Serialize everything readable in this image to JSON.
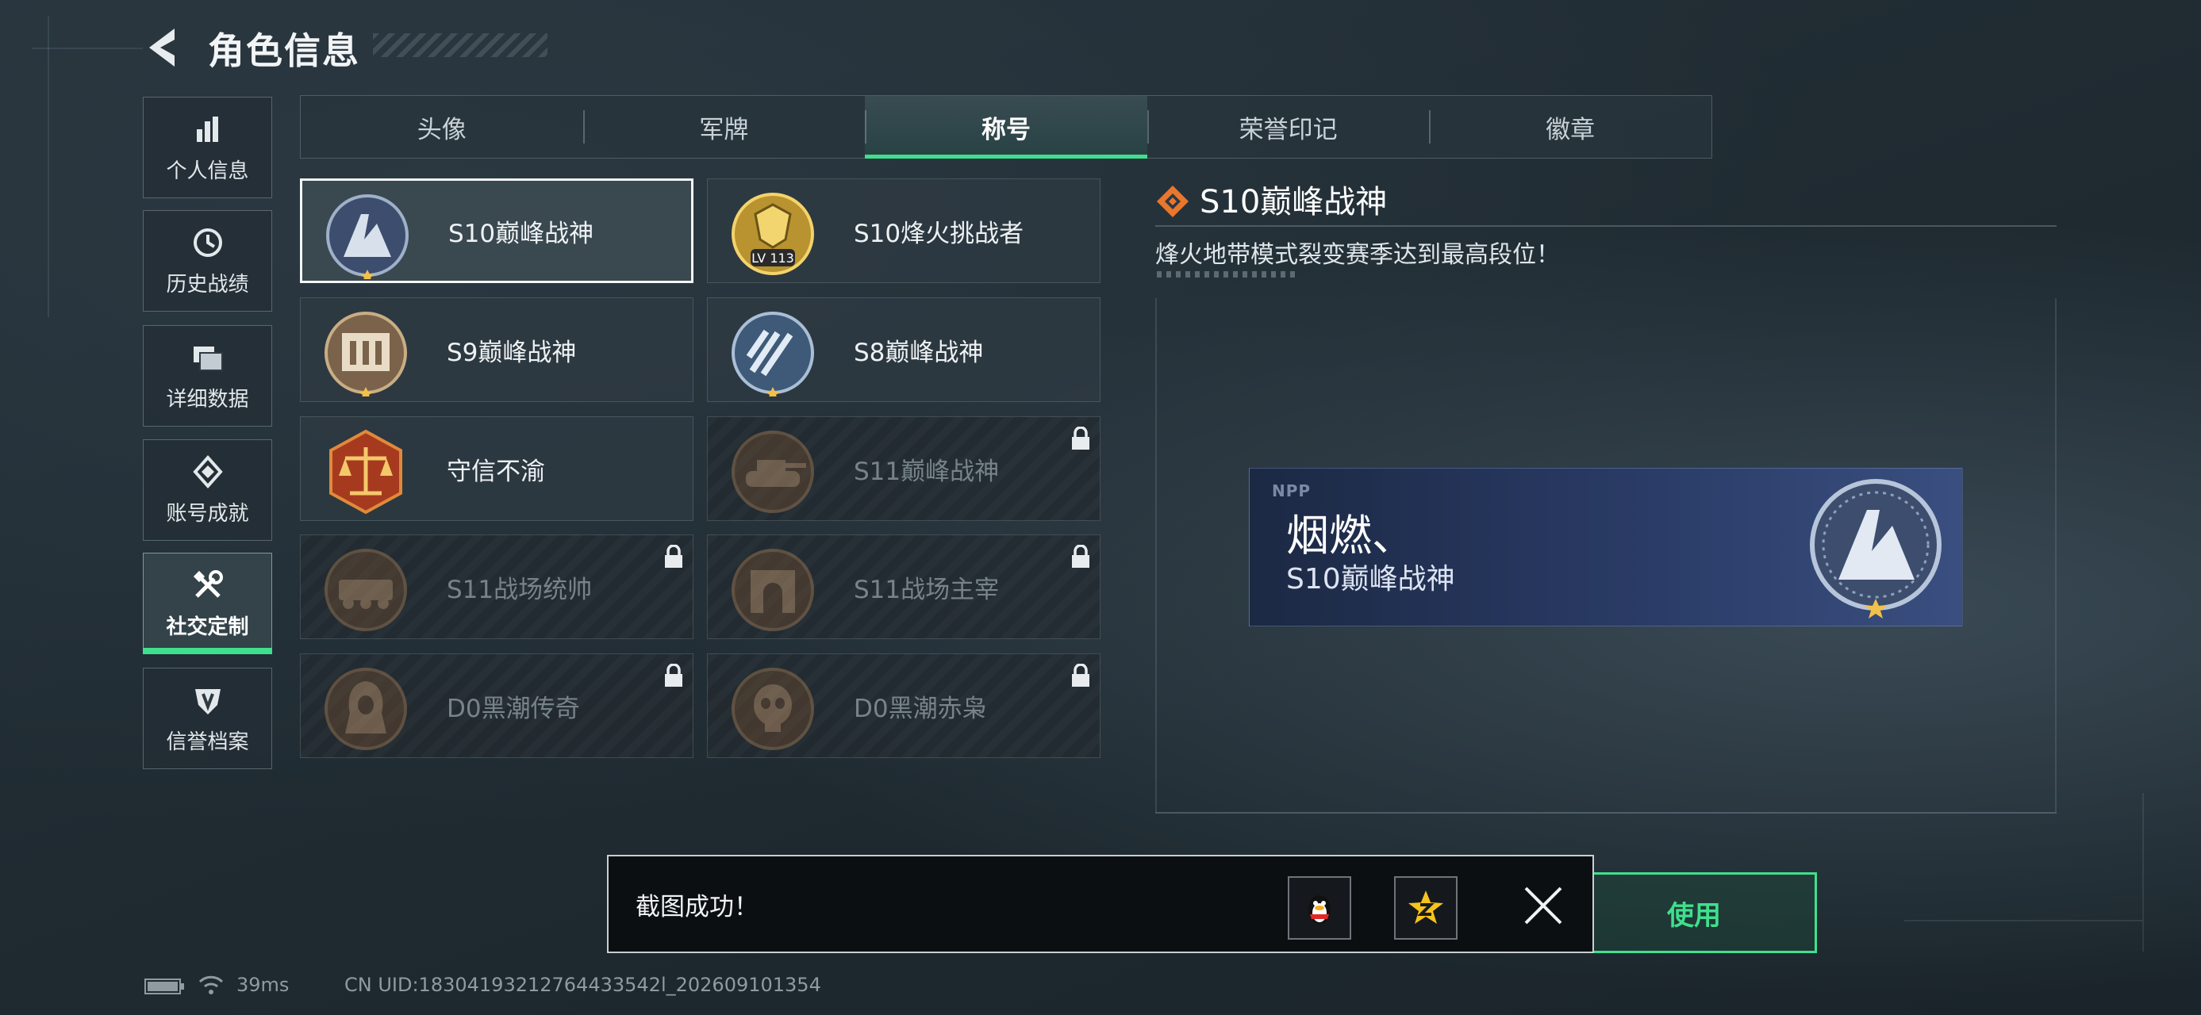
{
  "header": {
    "title": "角色信息"
  },
  "sidebar": {
    "items": [
      {
        "label": "个人信息",
        "icon": "bar-chart-icon"
      },
      {
        "label": "历史战绩",
        "icon": "clock-icon"
      },
      {
        "label": "详细数据",
        "icon": "folder-icon"
      },
      {
        "label": "账号成就",
        "icon": "achievement-icon"
      },
      {
        "label": "社交定制",
        "icon": "tools-icon",
        "active": true
      },
      {
        "label": "信誉档案",
        "icon": "shield-icon"
      }
    ]
  },
  "tabs": [
    {
      "label": "头像"
    },
    {
      "label": "军牌"
    },
    {
      "label": "称号",
      "active": true
    },
    {
      "label": "荣誉印记"
    },
    {
      "label": "徽章"
    }
  ],
  "titles": [
    {
      "name": "S10巅峰战神",
      "locked": false,
      "selected": true,
      "medal": "tower-medal-icon"
    },
    {
      "name": "S10烽火挑战者",
      "locked": false,
      "medal": "gold-lv-medal-icon",
      "level": "LV 113"
    },
    {
      "name": "S9巅峰战神",
      "locked": false,
      "medal": "building-medal-icon"
    },
    {
      "name": "S8巅峰战神",
      "locked": false,
      "medal": "stripe-medal-icon"
    },
    {
      "name": "守信不渝",
      "locked": false,
      "medal": "scales-medal-icon"
    },
    {
      "name": "S11巅峰战神",
      "locked": true,
      "medal": "tank-medal-icon"
    },
    {
      "name": "S11战场统帅",
      "locked": true,
      "medal": "vehicle-medal-icon"
    },
    {
      "name": "S11战场主宰",
      "locked": true,
      "medal": "arch-medal-icon"
    },
    {
      "name": "D0黑潮传奇",
      "locked": true,
      "medal": "hooded-figure-medal-icon"
    },
    {
      "name": "D0黑潮赤枭",
      "locked": true,
      "medal": "skull-medal-icon"
    }
  ],
  "detail": {
    "title": "S10巅峰战神",
    "description": "烽火地带模式裂变赛季达到最高段位！"
  },
  "preview": {
    "logo": "NPP",
    "player_name": "烟燃、",
    "title": "S10巅峰战神"
  },
  "use_button": {
    "label": "使用"
  },
  "toast": {
    "message": "截图成功！",
    "share_qq_icon": "qq-penguin-icon",
    "share_qzone_icon": "qzone-star-icon"
  },
  "status_bar": {
    "ping": "39ms",
    "uid": "CN UID:18304193212764433542l_202609101354"
  },
  "colors": {
    "accent_green": "#3fe08d",
    "toast_bg": "#0c0f12",
    "preview_blue": "#2a3b66"
  }
}
